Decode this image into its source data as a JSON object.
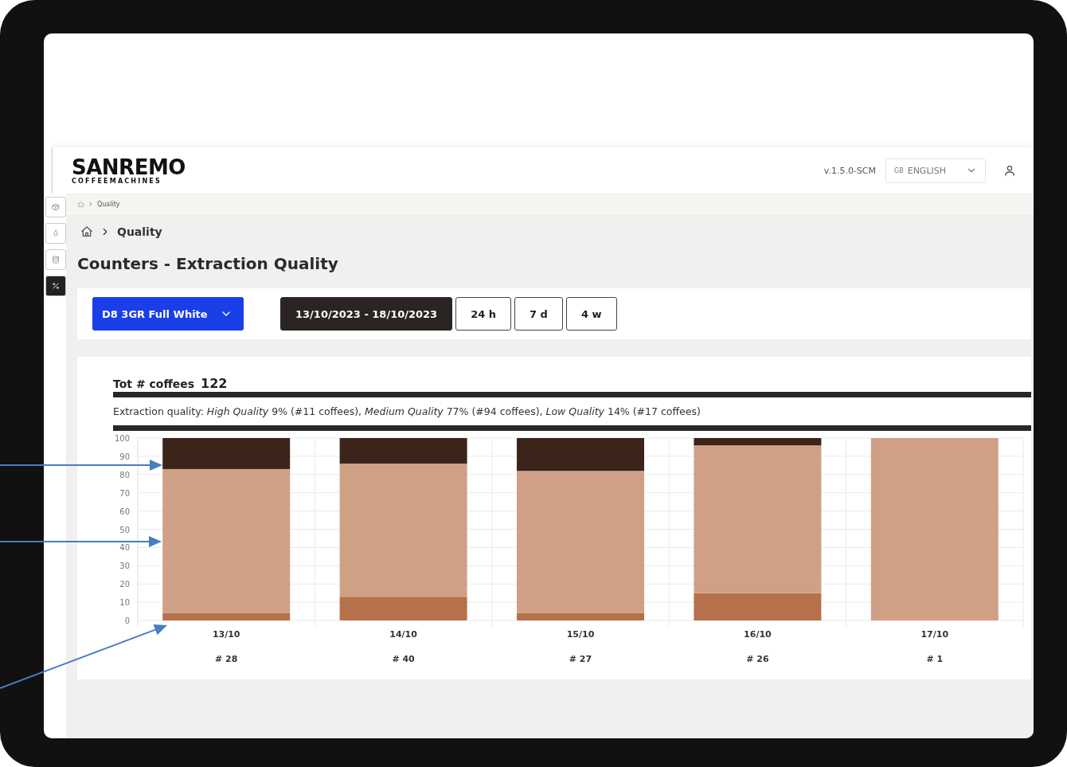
{
  "header": {
    "logo": "SANREMO",
    "logo_subtitle": "COFFEEMACHINES",
    "version": "v.1.5.0-SCM",
    "language": {
      "flag": "GB",
      "label": "ENGLISH"
    }
  },
  "sidebar": {
    "items": [
      {
        "selected": false
      },
      {
        "selected": false
      },
      {
        "selected": false
      },
      {
        "selected": true
      }
    ]
  },
  "top_breadcrumb": [
    "Quality"
  ],
  "breadcrumb": [
    "Quality"
  ],
  "title": "Counters - Extraction Quality",
  "toolbar": {
    "machine": "D8 3GR Full White",
    "periods": [
      {
        "label": "13/10/2023 - 18/10/2023",
        "selected": true
      },
      {
        "label": "24 h",
        "selected": false
      },
      {
        "label": "7 d",
        "selected": false
      },
      {
        "label": "4 w",
        "selected": false
      }
    ]
  },
  "summary": {
    "label": "Tot # coffees",
    "total": "122",
    "text": "Extraction quality: *High Quality* 9% (#11 coffees), *Medium Quality* 77% (#94 coffees), *Low Quality* 14% (#17 coffees)"
  },
  "chart": {
    "counts": [
      "# 28",
      "# 40",
      "# 27",
      "# 26",
      "# 1"
    ],
    "chart_data": {
      "type": "bar",
      "stacked": true,
      "grid": true,
      "categories": [
        "13/10",
        "14/10",
        "15/10",
        "16/10",
        "17/10"
      ],
      "ylim": [
        0,
        100
      ],
      "yticks": [
        0,
        10,
        20,
        30,
        40,
        50,
        60,
        70,
        80,
        90,
        100
      ],
      "series": [
        {
          "color": "#b5714a",
          "values": [
            4,
            13,
            4,
            15,
            0
          ]
        },
        {
          "color": "#cfa085",
          "values": [
            79,
            73,
            78,
            81,
            100
          ]
        },
        {
          "color": "#3b241a",
          "values": [
            17,
            14,
            18,
            4,
            0
          ]
        }
      ]
    }
  }
}
